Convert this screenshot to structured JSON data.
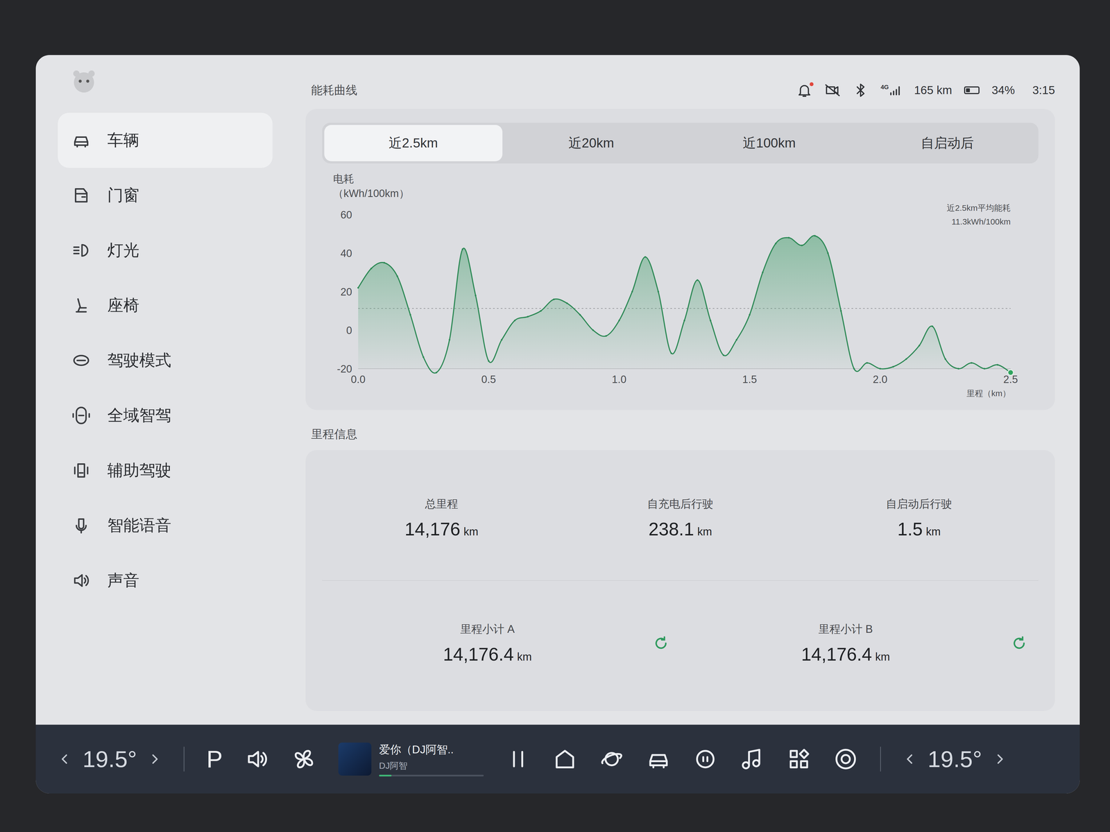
{
  "status_bar": {
    "notification_unread": true,
    "network": "4G",
    "range": "165 km",
    "battery": "34%",
    "battery_level": 0.34,
    "time": "3:15"
  },
  "sidebar": {
    "items": [
      {
        "label": "车辆",
        "selected": true
      },
      {
        "label": "门窗",
        "selected": false
      },
      {
        "label": "灯光",
        "selected": false
      },
      {
        "label": "座椅",
        "selected": false
      },
      {
        "label": "驾驶模式",
        "selected": false
      },
      {
        "label": "全域智驾",
        "selected": false
      },
      {
        "label": "辅助驾驶",
        "selected": false
      },
      {
        "label": "智能语音",
        "selected": false
      },
      {
        "label": "声音",
        "selected": false
      }
    ]
  },
  "chart": {
    "title": "能耗曲线",
    "tabs": [
      {
        "label": "近2.5km",
        "selected": true
      },
      {
        "label": "近20km",
        "selected": false
      },
      {
        "label": "近100km",
        "selected": false
      },
      {
        "label": "自启动后",
        "selected": false
      }
    ],
    "y_label": "电耗",
    "y_unit": "（kWh/100km）",
    "y_ticks": [
      "60",
      "40",
      "20",
      "0",
      "-20"
    ],
    "x_ticks": [
      "0.0",
      "0.5",
      "1.0",
      "1.5",
      "2.0",
      "2.5"
    ],
    "x_label": "里程（km）",
    "average_label": "近2.5km平均能耗",
    "average_value": "11.3kWh/100km",
    "average": 11.3,
    "values": [
      22,
      32,
      35,
      28,
      8,
      -14,
      -22,
      -5,
      42,
      18,
      -16,
      -5,
      5,
      7,
      10,
      16,
      14,
      8,
      0,
      -3,
      5,
      20,
      38,
      20,
      -12,
      5,
      26,
      5,
      -13,
      -5,
      8,
      30,
      45,
      48,
      44,
      49,
      40,
      10,
      -20,
      -17,
      -20,
      -19,
      -15,
      -8,
      2,
      -15,
      -20,
      -17,
      -20,
      -18,
      -22
    ]
  },
  "mileage": {
    "title": "里程信息",
    "stats": [
      {
        "label": "总里程",
        "value": "14,176",
        "unit": "km"
      },
      {
        "label": "自充电后行驶",
        "value": "238.1",
        "unit": "km"
      },
      {
        "label": "自启动后行驶",
        "value": "1.5",
        "unit": "km"
      }
    ],
    "trips": [
      {
        "label": "里程小计 A",
        "value": "14,176.4",
        "unit": "km"
      },
      {
        "label": "里程小计 B",
        "value": "14,176.4",
        "unit": "km"
      }
    ]
  },
  "dock": {
    "left_temp": "19.5°",
    "right_temp": "19.5°",
    "parking": "P",
    "media": {
      "title": "爱你（DJ阿智..",
      "artist": "DJ阿智",
      "playing": true,
      "progress": 0.12
    }
  }
}
